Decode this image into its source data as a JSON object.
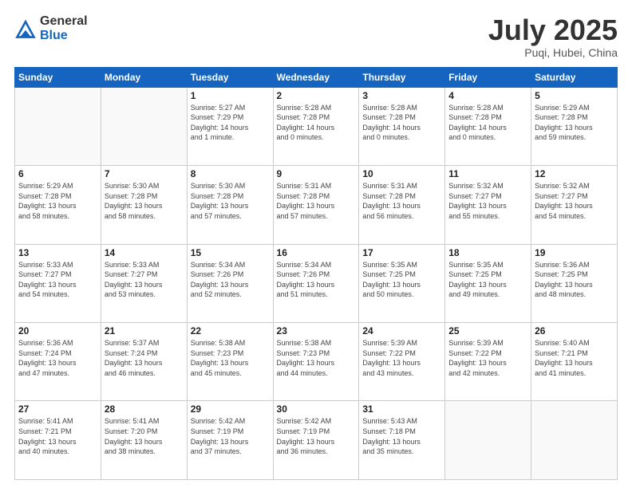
{
  "logo": {
    "general": "General",
    "blue": "Blue"
  },
  "header": {
    "month": "July 2025",
    "location": "Puqi, Hubei, China"
  },
  "weekdays": [
    "Sunday",
    "Monday",
    "Tuesday",
    "Wednesday",
    "Thursday",
    "Friday",
    "Saturday"
  ],
  "weeks": [
    [
      {
        "day": "",
        "info": ""
      },
      {
        "day": "",
        "info": ""
      },
      {
        "day": "1",
        "info": "Sunrise: 5:27 AM\nSunset: 7:29 PM\nDaylight: 14 hours\nand 1 minute."
      },
      {
        "day": "2",
        "info": "Sunrise: 5:28 AM\nSunset: 7:28 PM\nDaylight: 14 hours\nand 0 minutes."
      },
      {
        "day": "3",
        "info": "Sunrise: 5:28 AM\nSunset: 7:28 PM\nDaylight: 14 hours\nand 0 minutes."
      },
      {
        "day": "4",
        "info": "Sunrise: 5:28 AM\nSunset: 7:28 PM\nDaylight: 14 hours\nand 0 minutes."
      },
      {
        "day": "5",
        "info": "Sunrise: 5:29 AM\nSunset: 7:28 PM\nDaylight: 13 hours\nand 59 minutes."
      }
    ],
    [
      {
        "day": "6",
        "info": "Sunrise: 5:29 AM\nSunset: 7:28 PM\nDaylight: 13 hours\nand 58 minutes."
      },
      {
        "day": "7",
        "info": "Sunrise: 5:30 AM\nSunset: 7:28 PM\nDaylight: 13 hours\nand 58 minutes."
      },
      {
        "day": "8",
        "info": "Sunrise: 5:30 AM\nSunset: 7:28 PM\nDaylight: 13 hours\nand 57 minutes."
      },
      {
        "day": "9",
        "info": "Sunrise: 5:31 AM\nSunset: 7:28 PM\nDaylight: 13 hours\nand 57 minutes."
      },
      {
        "day": "10",
        "info": "Sunrise: 5:31 AM\nSunset: 7:28 PM\nDaylight: 13 hours\nand 56 minutes."
      },
      {
        "day": "11",
        "info": "Sunrise: 5:32 AM\nSunset: 7:27 PM\nDaylight: 13 hours\nand 55 minutes."
      },
      {
        "day": "12",
        "info": "Sunrise: 5:32 AM\nSunset: 7:27 PM\nDaylight: 13 hours\nand 54 minutes."
      }
    ],
    [
      {
        "day": "13",
        "info": "Sunrise: 5:33 AM\nSunset: 7:27 PM\nDaylight: 13 hours\nand 54 minutes."
      },
      {
        "day": "14",
        "info": "Sunrise: 5:33 AM\nSunset: 7:27 PM\nDaylight: 13 hours\nand 53 minutes."
      },
      {
        "day": "15",
        "info": "Sunrise: 5:34 AM\nSunset: 7:26 PM\nDaylight: 13 hours\nand 52 minutes."
      },
      {
        "day": "16",
        "info": "Sunrise: 5:34 AM\nSunset: 7:26 PM\nDaylight: 13 hours\nand 51 minutes."
      },
      {
        "day": "17",
        "info": "Sunrise: 5:35 AM\nSunset: 7:25 PM\nDaylight: 13 hours\nand 50 minutes."
      },
      {
        "day": "18",
        "info": "Sunrise: 5:35 AM\nSunset: 7:25 PM\nDaylight: 13 hours\nand 49 minutes."
      },
      {
        "day": "19",
        "info": "Sunrise: 5:36 AM\nSunset: 7:25 PM\nDaylight: 13 hours\nand 48 minutes."
      }
    ],
    [
      {
        "day": "20",
        "info": "Sunrise: 5:36 AM\nSunset: 7:24 PM\nDaylight: 13 hours\nand 47 minutes."
      },
      {
        "day": "21",
        "info": "Sunrise: 5:37 AM\nSunset: 7:24 PM\nDaylight: 13 hours\nand 46 minutes."
      },
      {
        "day": "22",
        "info": "Sunrise: 5:38 AM\nSunset: 7:23 PM\nDaylight: 13 hours\nand 45 minutes."
      },
      {
        "day": "23",
        "info": "Sunrise: 5:38 AM\nSunset: 7:23 PM\nDaylight: 13 hours\nand 44 minutes."
      },
      {
        "day": "24",
        "info": "Sunrise: 5:39 AM\nSunset: 7:22 PM\nDaylight: 13 hours\nand 43 minutes."
      },
      {
        "day": "25",
        "info": "Sunrise: 5:39 AM\nSunset: 7:22 PM\nDaylight: 13 hours\nand 42 minutes."
      },
      {
        "day": "26",
        "info": "Sunrise: 5:40 AM\nSunset: 7:21 PM\nDaylight: 13 hours\nand 41 minutes."
      }
    ],
    [
      {
        "day": "27",
        "info": "Sunrise: 5:41 AM\nSunset: 7:21 PM\nDaylight: 13 hours\nand 40 minutes."
      },
      {
        "day": "28",
        "info": "Sunrise: 5:41 AM\nSunset: 7:20 PM\nDaylight: 13 hours\nand 38 minutes."
      },
      {
        "day": "29",
        "info": "Sunrise: 5:42 AM\nSunset: 7:19 PM\nDaylight: 13 hours\nand 37 minutes."
      },
      {
        "day": "30",
        "info": "Sunrise: 5:42 AM\nSunset: 7:19 PM\nDaylight: 13 hours\nand 36 minutes."
      },
      {
        "day": "31",
        "info": "Sunrise: 5:43 AM\nSunset: 7:18 PM\nDaylight: 13 hours\nand 35 minutes."
      },
      {
        "day": "",
        "info": ""
      },
      {
        "day": "",
        "info": ""
      }
    ]
  ]
}
